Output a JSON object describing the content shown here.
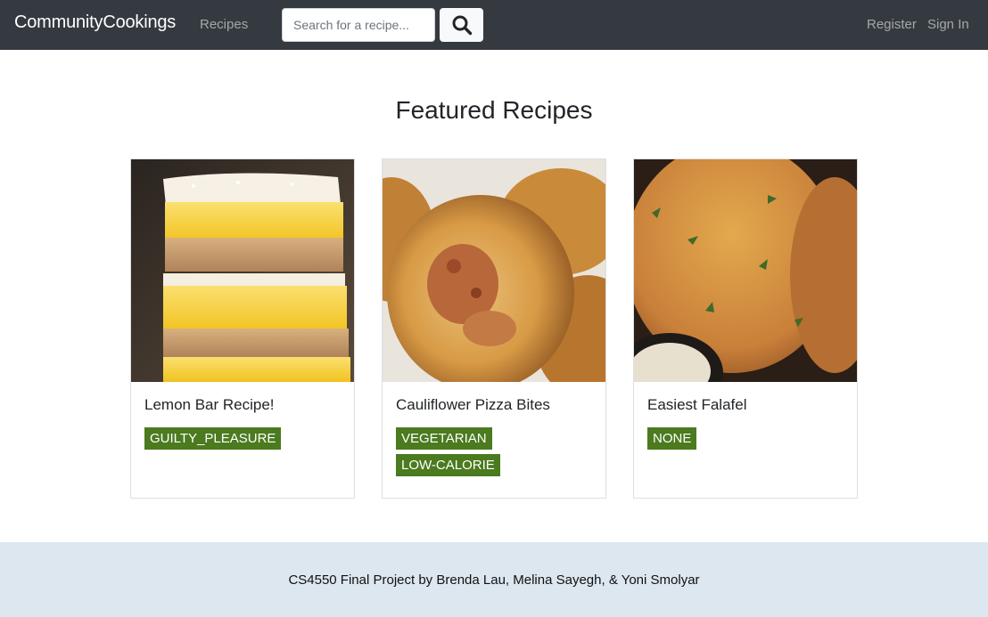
{
  "header": {
    "brand": "CommunityCookings",
    "nav_recipes": "Recipes",
    "nav_register": "Register",
    "nav_signin": "Sign In"
  },
  "search": {
    "placeholder": "Search for a recipe...",
    "button_icon": "search-icon"
  },
  "main": {
    "title": "Featured Recipes",
    "cards": [
      {
        "title": "Lemon Bar Recipe!",
        "tags": [
          "GUILTY_PLEASURE"
        ],
        "image": "lemon-bar-photo"
      },
      {
        "title": "Cauliflower Pizza Bites",
        "tags": [
          "VEGETARIAN",
          "LOW-CALORIE"
        ],
        "image": "cauliflower-pizza-photo"
      },
      {
        "title": "Easiest Falafel",
        "tags": [
          "NONE"
        ],
        "image": "falafel-photo"
      }
    ]
  },
  "footer": {
    "text": "CS4550 Final Project by Brenda Lau, Melina Sayegh, & Yoni Smolyar"
  },
  "colors": {
    "navbar_bg": "#343a40",
    "tag_bg": "#4b7a1f",
    "footer_bg": "#dde7f0"
  }
}
